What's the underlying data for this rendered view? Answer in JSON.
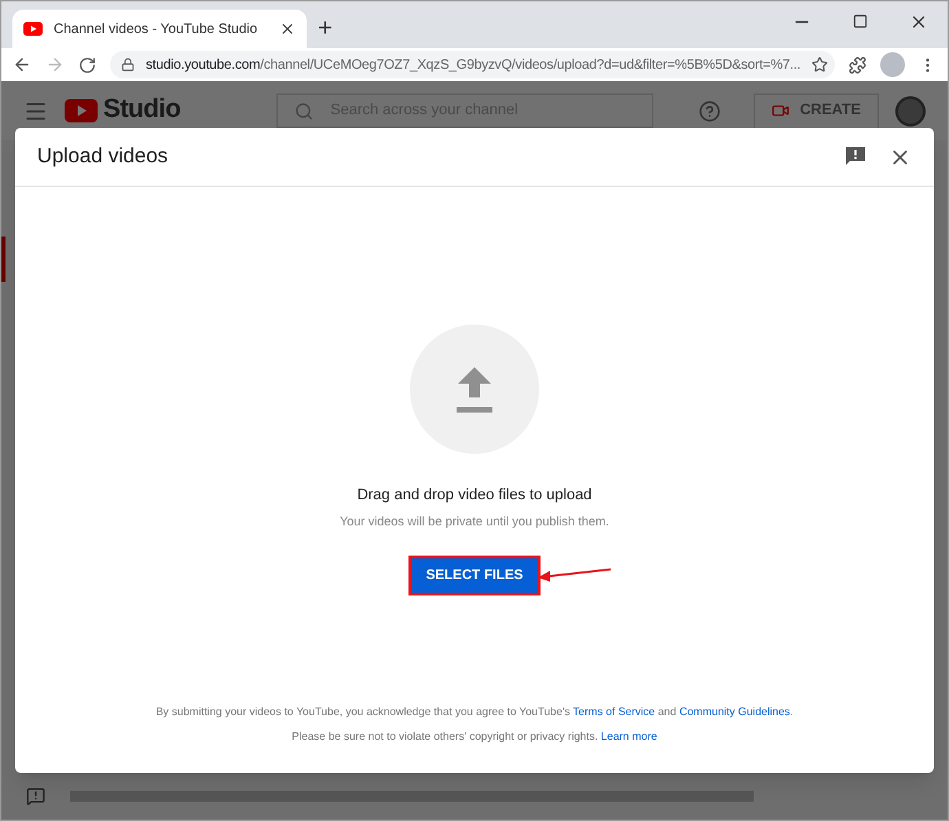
{
  "browser": {
    "tab_title": "Channel videos - YouTube Studio",
    "new_tab": "+",
    "url_host": "studio.youtube.com",
    "url_path": "/channel/UCeMOeg7OZ7_XqzS_G9byzvQ/videos/upload?d=ud&filter=%5B%5D&sort=%7..."
  },
  "header": {
    "brand": "Studio",
    "search": {
      "placeholder": "Search across your channel"
    },
    "create_label": "CREATE"
  },
  "dialog": {
    "title": "Upload videos",
    "drop_text": "Drag and drop video files to upload",
    "privacy_note": "Your videos will be private until you publish them.",
    "select_button": {
      "label": "SELECT FILES",
      "highlighted": true
    },
    "legal_line_1": {
      "text": "By submitting your videos to YouTube, you acknowledge that you agree to YouTube's",
      "link_1": "Terms of Service",
      "joiner": "and",
      "link_2": "Community Guidelines",
      "end": "."
    },
    "legal_line_2": {
      "text": "Please be sure not to violate others' copyright or privacy rights.",
      "link": "Learn more"
    }
  }
}
